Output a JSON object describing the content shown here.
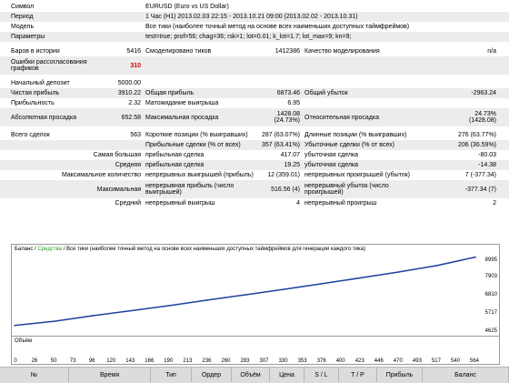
{
  "report": {
    "symbol_label": "Символ",
    "symbol_value": "EURUSD (Euro vs US Dollar)",
    "period_label": "Период",
    "period_value": "1 Час (H1) 2013.02.03 22:15 - 2013.10.21 09:00 (2013.02.02 - 2013.10.31)",
    "model_label": "Модель",
    "model_value": "Все тики (наиболее точный метод на основе всех наименьших доступных таймфреймов)",
    "params_label": "Параметры",
    "params_value": "test=true; prof=56; chag=36; rsk=1; lot=0.01; k_lot=1.7; lot_max=9; kn=9;",
    "bars_label": "Баров в истории",
    "bars_value": "5416",
    "ticks_label": "Смоделировано тиков",
    "ticks_value": "1412386",
    "quality_label": "Качество моделирования",
    "quality_value": "n/a",
    "errors_label": "Ошибки рассогласования графиков",
    "errors_value": "310",
    "deposit_label": "Начальный депозит",
    "deposit_value": "5000.00",
    "net_label": "Чистая прибыль",
    "net_value": "3910.22",
    "gross_profit_label": "Общая прибыль",
    "gross_profit_value": "6873.46",
    "gross_loss_label": "Общий убыток",
    "gross_loss_value": "-2963.24",
    "pf_label": "Прибыльность",
    "pf_value": "2.32",
    "ep_label": "Матожидание выигрыша",
    "ep_value": "6.95",
    "abs_dd_label": "Абсолютная просадка",
    "abs_dd_value": "652.58",
    "max_dd_label": "Максимальная просадка",
    "max_dd_value_1": "1428.08",
    "max_dd_value_2": "(24.73%)",
    "rel_dd_label": "Относительная просадка",
    "rel_dd_value_1": "24.73%",
    "rel_dd_value_2": "(1428.08)",
    "trades_label": "Всего сделок",
    "trades_value": "563",
    "short_label": "Короткие позиции (% выигравших)",
    "short_value": "287 (63.07%)",
    "long_label": "Длинные позиции (% выигравших)",
    "long_value": "276 (63.77%)",
    "profit_trades_label": "Прибыльные сделки (% от всех)",
    "profit_trades_value": "357 (63.41%)",
    "loss_trades_label": "Убыточные сделки (% от всех)",
    "loss_trades_value": "206 (36.59%)",
    "largest_label": "Самая большая",
    "largest_profit_label": "прибыльная сделка",
    "largest_profit_value": "417.07",
    "largest_loss_label": "убыточная сделка",
    "largest_loss_value": "-80.03",
    "average_label": "Средняя",
    "average_profit_label": "прибыльная сделка",
    "average_profit_value": "19.25",
    "average_loss_label": "убыточная сделка",
    "average_loss_value": "-14.38",
    "maxcount_label": "Максимальное количество",
    "maxcons_wins_label": "непрерывных выигрышей (прибыль)",
    "maxcons_wins_value": "12 (359.01)",
    "maxcons_losses_label": "непрерывных проигрышей (убыток)",
    "maxcons_losses_value": "7 (-377.34)",
    "maximal_label": "Максимальная",
    "maxprofit_label": "непрерывная прибыль (число выигрышей)",
    "maxprofit_value": "516.56 (4)",
    "maxloss_label": "непрерывный убыток (число проигрышей)",
    "maxloss_value": "-377.34 (7)",
    "avg_label": "Средний",
    "avg_wins_label": "непрерывный выигрыш",
    "avg_wins_value": "4",
    "avg_losses_label": "непрерывный проигрыш",
    "avg_losses_value": "2"
  },
  "chart": {
    "legend_balance": "Баланс",
    "legend_sep": " / ",
    "legend_funds": "Средства",
    "legend_rest": " / Все тики (наиболее точный метод на основе всех наименьших доступных таймфреймов для генерации каждого тика)",
    "y_ticks": [
      "8995",
      "7903",
      "6810",
      "5717",
      "4625"
    ],
    "volume_label": "Объём",
    "x_ticks": [
      "0",
      "26",
      "50",
      "73",
      "96",
      "120",
      "143",
      "166",
      "190",
      "213",
      "236",
      "260",
      "283",
      "307",
      "330",
      "353",
      "376",
      "400",
      "423",
      "446",
      "470",
      "493",
      "517",
      "540",
      "564"
    ],
    "colors": {
      "balance": "#1f3fa0",
      "equity": "#2a9a2a"
    }
  },
  "chart_data": {
    "type": "line",
    "x": [
      0,
      50,
      96,
      143,
      190,
      236,
      283,
      330,
      376,
      423,
      470,
      517,
      564
    ],
    "series": [
      {
        "name": "Баланс",
        "values": [
          5000,
          5250,
          5560,
          5850,
          6140,
          6450,
          6760,
          7070,
          7390,
          7720,
          8060,
          8430,
          8910
        ]
      }
    ],
    "ylim": [
      4625,
      8995
    ],
    "xlim": [
      0,
      564
    ]
  },
  "table_header": [
    "№",
    "Время",
    "Тип",
    "Ордер",
    "Объём",
    "Цена",
    "S / L",
    "T / P",
    "Прибыль",
    "Баланс"
  ]
}
